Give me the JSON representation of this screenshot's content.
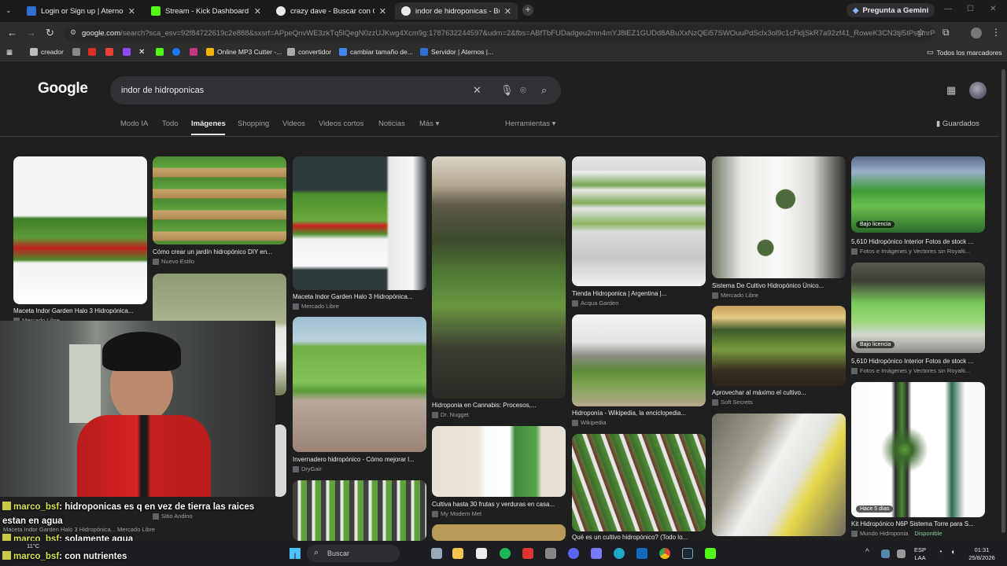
{
  "browser": {
    "tabs": [
      {
        "title": "Login or Sign up | Aternos | Fre",
        "active": false
      },
      {
        "title": "Stream - Kick Dashboard",
        "active": false
      },
      {
        "title": "crazy dave - Buscar con Google",
        "active": false
      },
      {
        "title": "indor de hidroponicas - Buscar",
        "active": true
      }
    ],
    "new_tab": "+",
    "gemini_label": "Pregunta a Gemini",
    "url_host": "google.com",
    "url_path": "/search?sca_esv=92f84722619c2e888&sxsrf=APpeQnvWE3zkTq5lQegN0zzUJKwg4Xcm9g:1787632244597&udm=2&fbs=ABfTbFUDadgeu2mn4mYJ8lEZ1GUDd8ABuXxNzQEi57SWOuuPdSclx3ol9c1cFkljSkR7a92zf41_RoweK3CN3tjl5tPsgmrPtMZ",
    "bookmarks": [
      {
        "label": "creador",
        "icon": "bookmark-creador-icon"
      },
      {
        "label": "",
        "icon": "gmail-icon"
      },
      {
        "label": "",
        "icon": "youtube-icon"
      },
      {
        "label": "",
        "icon": "twitch-icon"
      },
      {
        "label": "",
        "icon": "x-icon"
      },
      {
        "label": "",
        "icon": "kick-icon"
      },
      {
        "label": "",
        "icon": "facebook-icon"
      },
      {
        "label": "",
        "icon": "instagram-icon"
      },
      {
        "label": "Online MP3 Cutter -...",
        "icon": "mp3cutter-icon"
      },
      {
        "label": "convertidor",
        "icon": "convertidor-icon"
      },
      {
        "label": "cambiar tamaño de...",
        "icon": "resize-icon"
      },
      {
        "label": "Servidor | Aternos |...",
        "icon": "aternos-icon"
      }
    ],
    "all_bookmarks": "Todos los marcadores"
  },
  "google": {
    "logo": "Google",
    "query": "indor de hidroponicas",
    "tabs": [
      "Modo IA",
      "Todo",
      "Imágenes",
      "Shopping",
      "Videos",
      "Videos cortos",
      "Noticias",
      "Más"
    ],
    "active_tab": "Imágenes",
    "tools": "Herramientas",
    "saved": "Guardados"
  },
  "results": [
    {
      "caption": "Maceta Indor Garden Halo 3 Hidropónica...",
      "source": "Mercado Libre",
      "badge": ""
    },
    {
      "caption": "Cómo crear un jardín hidropónico DIY en...",
      "source": "Nuevo Estilo",
      "badge": ""
    },
    {
      "caption": "Maceta Indor Garden Halo 3 Hidropónica...",
      "source": "Mercado Libre",
      "badge": ""
    },
    {
      "caption": "Hidroponia en Cannabis: Procesos,...",
      "source": "Dr. Nugget",
      "badge": ""
    },
    {
      "caption": "Tienda Hidroponica | Argentina |...",
      "source": "Acqua Garden",
      "badge": ""
    },
    {
      "caption": "Sistema De Cultivo Hidropónico Único...",
      "source": "Mercado Libre",
      "badge": ""
    },
    {
      "caption": "5,610 Hidropónico Interior Fotos de stock ...",
      "source": "Fotos e Imágenes y Vectores sin Royalti...",
      "badge": "Bajo licencia"
    },
    {
      "caption": "Invernadero hidropónico - Cómo mejorar l...",
      "source": "DryGair",
      "badge": ""
    },
    {
      "caption": "Hidroponía - Wikipedia, la enciclopedia...",
      "source": "Wikipedia",
      "badge": ""
    },
    {
      "caption": "Aprovechar al máximo el cultivo...",
      "source": "Soft Secrets",
      "badge": ""
    },
    {
      "caption": "5,610 Hidropónico Interior Fotos de stock ...",
      "source": "Fotos e Imágenes y Vectores sin Royalti...",
      "badge": "Bajo licencia"
    },
    {
      "caption": "Cultiva hasta 30 frutas y verduras en casa...",
      "source": "My Modern Met",
      "badge": ""
    },
    {
      "caption": "Qué es un cultivo hidropónico? (Todo lo...",
      "source": "",
      "badge": ""
    },
    {
      "caption": "Kit Hidropónico N6P Sistema Torre para S...",
      "source": "Mundo Hidroponia",
      "badge": "Hace 5 días",
      "extra": "Disponible"
    },
    {
      "caption": "Maceta Indor Garden Halo 3 Hidropónica...",
      "source": "Mercado Libre",
      "badge": ""
    },
    {
      "caption": "",
      "source": "Sitio Andino",
      "badge": ""
    }
  ],
  "chat": [
    {
      "user": "marco_bsf",
      "text": ": hidroponicas es q en vez de tierra las raices"
    },
    {
      "user": "",
      "text": "estan en agua"
    },
    {
      "user": "marco_bsf",
      "text": ": solamente agua"
    },
    {
      "user": "marco_bsf",
      "text": ": con nutrientes"
    }
  ],
  "taskbar": {
    "search": "Buscar",
    "lang": "ESP",
    "lang2": "LAA",
    "time": "01:31",
    "date": "25/8/2026",
    "temp": "11°C"
  },
  "colors": {
    "page_bg": "#1f1f1f",
    "search_bg": "#303134",
    "chat_user": "#d6e54a"
  }
}
